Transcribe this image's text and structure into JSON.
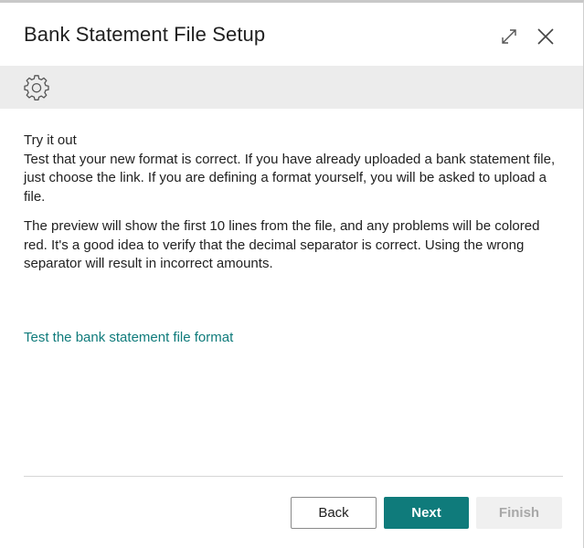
{
  "dialog": {
    "title": "Bank Statement File Setup",
    "icons": {
      "expand": "expand-icon",
      "close": "close-icon",
      "settings": "gear-icon"
    }
  },
  "content": {
    "heading": "Try it out",
    "paragraph1": "Test that your new format is correct. If you have already uploaded a bank statement file, just choose the link. If you are defining a format yourself, you will be asked to upload a file.",
    "paragraph2": "The preview will show the first 10 lines from the file, and any problems will be colored red. It's a good idea to verify that the decimal separator is correct. Using the wrong separator will result in incorrect amounts.",
    "link": "Test the bank statement file format"
  },
  "footer": {
    "back_label": "Back",
    "next_label": "Next",
    "finish_label": "Finish"
  },
  "colors": {
    "accent": "#0f7b7b",
    "toolbar_bg": "#ececec",
    "disabled_bg": "#f0f0f0",
    "disabled_text": "#a8a8a8"
  }
}
